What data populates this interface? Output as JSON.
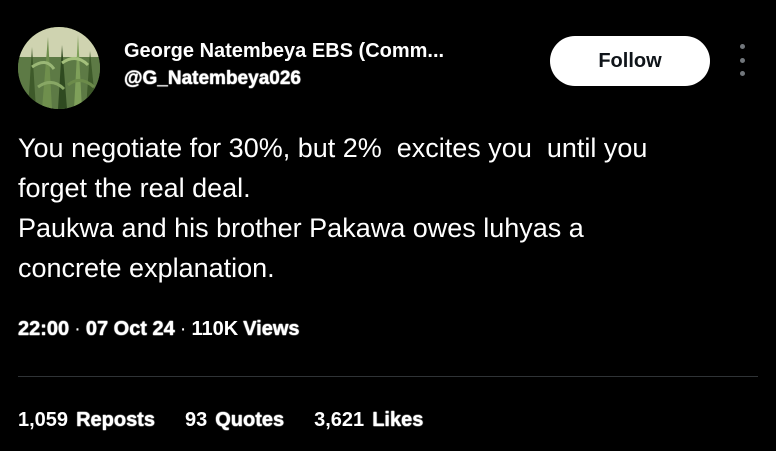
{
  "author": {
    "display_name": "George Natembeya EBS (Comm...",
    "handle": "@G_Natembeya026",
    "avatar_icon": "profile-photo-maize-field"
  },
  "follow_label": "Follow",
  "more_icon": "vertical-ellipsis-icon",
  "tweet_lines": [
    "You negotiate for 30%, but 2%  excites you  until you",
    "forget the real deal.",
    "Paukwa and his brother Pakawa owes luhyas a",
    "concrete explanation."
  ],
  "meta": {
    "time": "22:00",
    "separator": "·",
    "date": "07 Oct 24",
    "views_count": "110K",
    "views_label": "Views"
  },
  "stats": {
    "reposts_count": "1,059",
    "reposts_label": "Reposts",
    "quotes_count": "93",
    "quotes_label": "Quotes",
    "likes_count": "3,621",
    "likes_label": "Likes"
  },
  "colors": {
    "background": "#000000",
    "text": "#ffffff",
    "divider": "#2f3336",
    "follow_bg": "#ffffff",
    "follow_text": "#0f1419"
  }
}
